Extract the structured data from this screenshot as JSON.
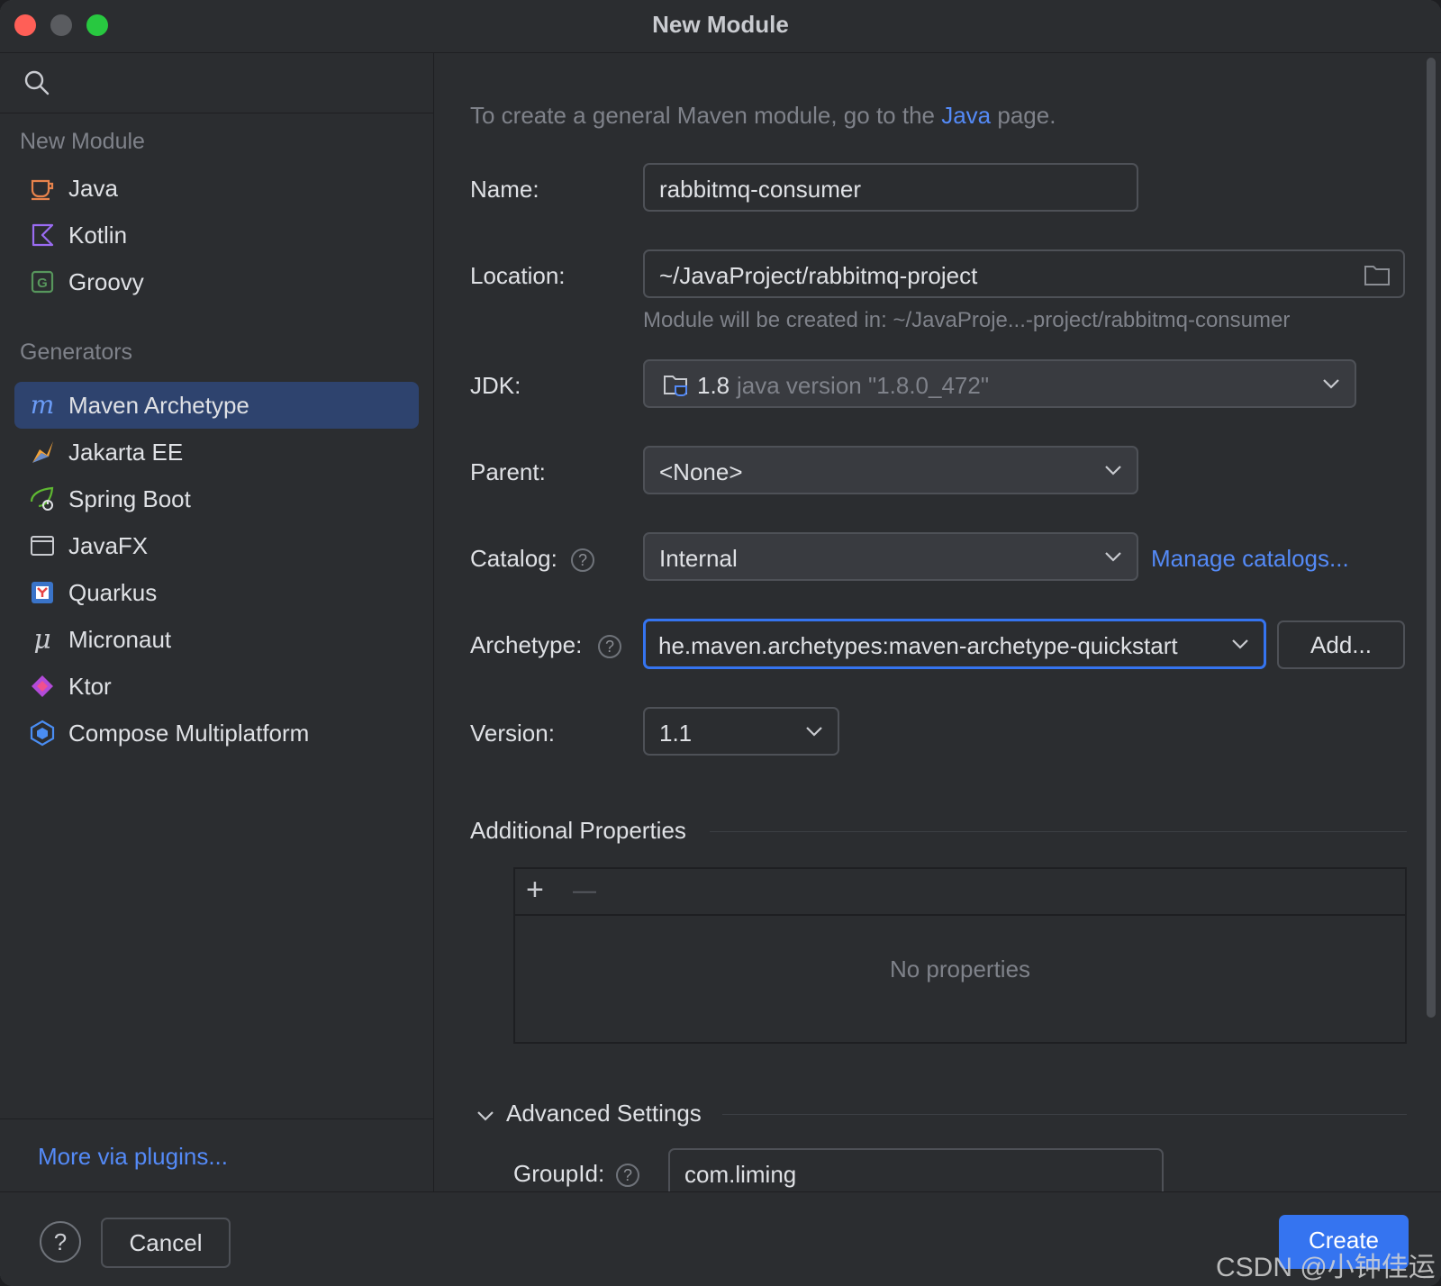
{
  "window": {
    "title": "New Module"
  },
  "sidebar": {
    "search_placeholder": "",
    "section_new_module": "New Module",
    "new_module_items": [
      {
        "label": "Java",
        "icon": "java-cup-icon"
      },
      {
        "label": "Kotlin",
        "icon": "kotlin-icon"
      },
      {
        "label": "Groovy",
        "icon": "groovy-icon"
      }
    ],
    "section_generators": "Generators",
    "generator_items": [
      {
        "label": "Maven Archetype",
        "icon": "maven-icon",
        "selected": true
      },
      {
        "label": "Jakarta EE",
        "icon": "jakarta-ee-icon"
      },
      {
        "label": "Spring Boot",
        "icon": "spring-boot-icon"
      },
      {
        "label": "JavaFX",
        "icon": "javafx-window-icon"
      },
      {
        "label": "Quarkus",
        "icon": "quarkus-icon"
      },
      {
        "label": "Micronaut",
        "icon": "micronaut-icon"
      },
      {
        "label": "Ktor",
        "icon": "ktor-icon"
      },
      {
        "label": "Compose Multiplatform",
        "icon": "compose-multiplatform-icon"
      }
    ],
    "more_plugins": "More via plugins..."
  },
  "main": {
    "hint_prefix": "To create a general Maven module, go to the ",
    "hint_link": "Java",
    "hint_suffix": " page.",
    "name_label": "Name:",
    "name_value": "rabbitmq-consumer",
    "location_label": "Location:",
    "location_value": "~/JavaProject/rabbitmq-project",
    "location_note": "Module will be created in: ~/JavaProje...-project/rabbitmq-consumer",
    "jdk_label": "JDK:",
    "jdk_version": "1.8",
    "jdk_detail": "java version \"1.8.0_472\"",
    "parent_label": "Parent:",
    "parent_value": "<None>",
    "catalog_label": "Catalog:",
    "catalog_value": "Internal",
    "manage_catalogs": "Manage catalogs...",
    "archetype_label": "Archetype:",
    "archetype_value": "he.maven.archetypes:maven-archetype-quickstart",
    "add_button": "Add...",
    "version_label": "Version:",
    "version_value": "1.1",
    "additional_properties": "Additional Properties",
    "add_icon": "+",
    "remove_icon": "—",
    "no_properties": "No properties",
    "advanced_settings": "Advanced Settings",
    "groupid_label": "GroupId:",
    "groupid_value": "com.liming"
  },
  "footer": {
    "help": "?",
    "cancel": "Cancel",
    "create": "Create",
    "watermark": "CSDN @小钟佳运"
  },
  "colors": {
    "accent": "#3574f0",
    "link": "#548af7",
    "selection": "#2e436e",
    "background": "#2b2d30"
  }
}
